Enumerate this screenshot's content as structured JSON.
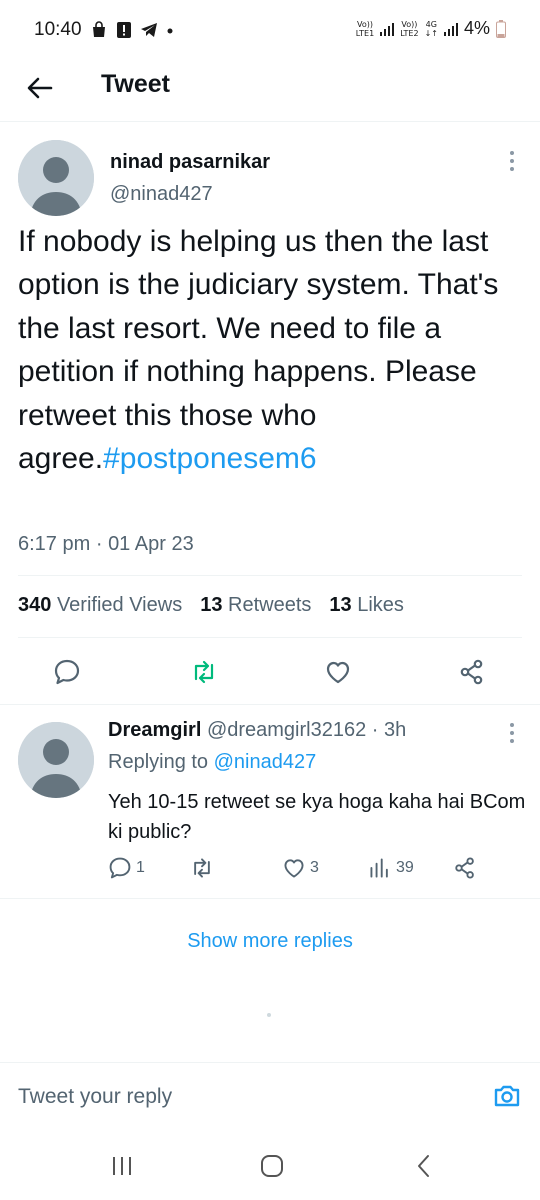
{
  "status_bar": {
    "time": "10:40",
    "sim1_top": "Vo))",
    "sim1_bottom": "LTE1",
    "sim2_top": "Vo))",
    "sim2_bottom": "LTE2",
    "network": "4G",
    "battery": "4%"
  },
  "header": {
    "title": "Tweet"
  },
  "tweet": {
    "author_name": "ninad pasarnikar",
    "author_handle": "@ninad427",
    "text": "If nobody is helping us then the last option is the judiciary system. That's the last resort. We need to file a petition if nothing happens. Please retweet this those who agree.",
    "hashtag": "#postponesem6",
    "time": "6:17 pm",
    "separator": "·",
    "date": "01 Apr 23",
    "stats": {
      "views_count": "340",
      "views_label": "Verified Views",
      "retweets_count": "13",
      "retweets_label": "Retweets",
      "likes_count": "13",
      "likes_label": "Likes"
    }
  },
  "reply": {
    "name": "Dreamgirl",
    "handle": "@dreamgirl32162",
    "separator": "·",
    "age": "3h",
    "replying_prefix": "Replying to",
    "replying_to": "@ninad427",
    "text": "Yeh 10-15 retweet se kya hoga kaha hai BCom ki public?",
    "reply_count": "1",
    "like_count": "3",
    "views_count": "39"
  },
  "show_more_label": "Show more replies",
  "compose": {
    "placeholder": "Tweet your reply"
  },
  "colors": {
    "accent": "#1d9bf0",
    "retweet_active": "#00ba7c",
    "text_primary": "#0f1419",
    "text_secondary": "#536471"
  },
  "icons": {
    "back": "arrow-left-icon",
    "more": "more-vertical-icon",
    "reply": "comment-icon",
    "retweet": "retweet-icon",
    "like": "heart-icon",
    "share": "share-icon",
    "views": "analytics-icon",
    "camera": "camera-icon"
  }
}
